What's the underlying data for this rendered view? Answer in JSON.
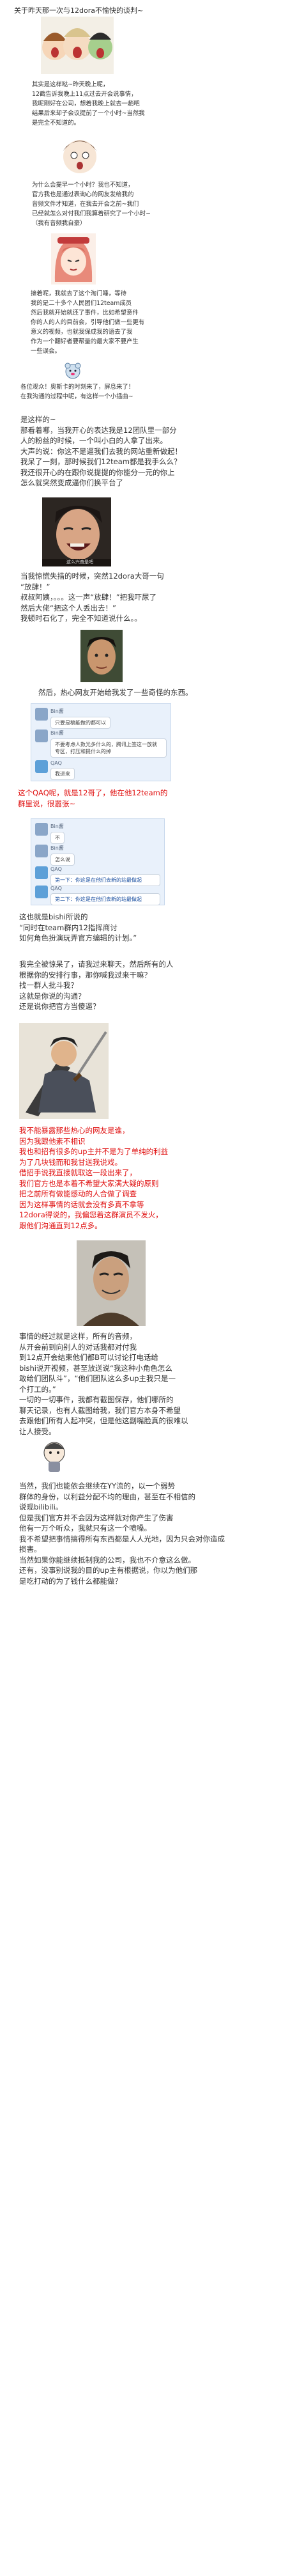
{
  "title": "关于昨天那一次与12dora不愉快的谈判~",
  "blocks": {
    "p1": "其实是这样哒~昨天晚上呢，\n12戳告诉我晚上11点过去开会说事情，\n我呢刚好在公司，想着我晚上就去一趟吧\n结果后来却子会议提前了一个小时~当然我\n是完全不知道的。",
    "p2": "为什么会提早一个小时？我也不知道，\n官方我也是通过表询心的网友发给我的\n音频文件才知道，在我去开会之前~我们\n已经就怎么对付我们我算着研究了一个小时~\n（我有音频我自豪）",
    "p3": "接着呢，我就去了这个淘门睡，等待\n我的是二十多个人民团们12team成员\n然后我就开始就还了事件，比如希望意件\n你的人的人的目前会，引导他们做一些更有\n意义的视频，也就我保成我的语去了我\n作为一个翻好者要帮量的最大家不要产生\n一些误会。",
    "p4": "各位观众！奥斯卡的时刻来了，屏息来了！\n在我沟通的过程中呢，有这样一个小插曲~",
    "p5": "是这样的~\n那看着哪，当我开心的表达我是12团队里一部分\n人的粉丝的时候，一个叫小白的人拿了出来。\n大声的说：你这不是逼我们去我的网站重新做起！\n我呆了一刻，那时候我们12team都是我手么么？\n我还很开心的在跟你说提提的你能分一元的你上\n怎么就突然变成逼你们换平台了",
    "p6": "当我惊慌失措的时候，突然12dora大哥一句\n“放肆！”\n叔叔阿姨，。。。这一声“放肆！”把我吓尿了\n然后大佬“把这个人丢出去！”\n我顿时石化了，完全不知道说什么。。",
    "p7": "然后，热心网友开始给我发了一些奇怪的东西。",
    "p8": "这个QAQ呢，就是12哥了，他在他12team的\n群里说，很嚣张~",
    "p9": "这也就是bishi所说的\n“同时在team群内12指挥商讨\n如何角色扮演玩弄官方编辑的计划。”",
    "p10": "我完全被惊呆了，请我过来聊天，然后所有的人\n根据你的安排行事，那你喊我过来干嘛？\n找一群人批斗我？\n这就是你说的沟通？\n还是说你把官方当傻逼？",
    "red1": "我不能暴露那些热心的网友是谁，\n因为我跟他素不相识\n我也和招有很多的up主并不是为了单纯的利益\n为了几块钱而和我甘送我说戏。\n借招手说我直接就取这一段出来了，\n我们官方也是本着不希望大家满大疑的原则\n把之前所有做能感动的人合做了调查\n因为这样事情的话就会没有多真不拿等\n12dora得说的，我偏您着这群演员不发火，\n跟他们沟通直到12点多。",
    "p11": "事情的经过就是这样，所有的音频，\n从开会前到向别人的对话我都对付我\n到12点开会结束他们都B可以讨论打电话给\nbishi说开视频，甚至放送说“我这种小角色怎么\n敢给们团队斗”，“他们团队这么多up主我只是一\n个打工的。”\n一切的一切事件，我都有截图保存，他们哪所的\n聊天记录，也有人截图给我，我们官方本身不希望\n去跟他们所有人起冲突，但是他这副嘴脸真的很难以\n让人接受。",
    "p12": "当然，我们也能依会继续在YY流的，以一个弱势\n群体的身份，以利益分配不均的理由，甚至在不相信的\n说现bilibili。\n但是我们官方并不会因为这样就对你产生了伤害\n他有一万个听众，我就只有这一个喷嗓。\n我不希望把事情搞得所有东西都是人人光地，因为只会对你造成\n损害。\n当然如果你能继续抵制我的公司，我也不介意这么做。\n还有，没事别说我的目的up主有根据说，你以为他们那\n是吃打动的为了钱什么都能做？"
  },
  "chat1": {
    "name1": "Bin酱",
    "msg1": "只要是稿能做的都可以",
    "name2": "Bin酱",
    "msg2": "不要考虑人数光多什么的，腾讯上签这一放就\n专区，打压和提什么的掉",
    "name3": "QAQ",
    "msg3": "我进来"
  },
  "chat2": {
    "name1": "Bin酱",
    "msg1": "不",
    "name2": "Bin酱",
    "msg2": "怎么说",
    "name3": "QAQ",
    "msg3": "第一下：你这是在他们去新的站最做起",
    "name4": "QAQ",
    "msg4": "第二下：你这是在他们去新的站最做起"
  },
  "captions": {
    "cap1": "这么兴奋是吧"
  }
}
